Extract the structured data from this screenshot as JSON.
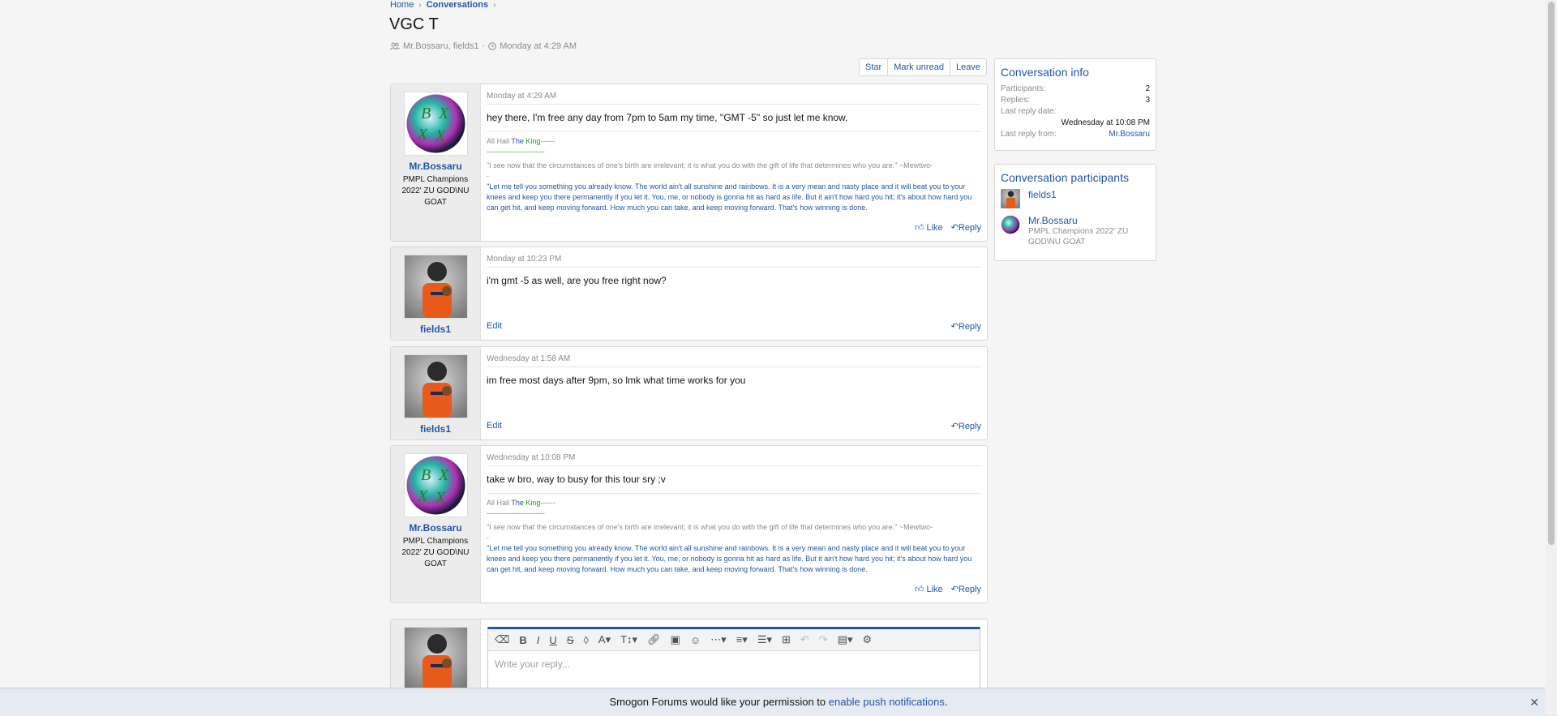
{
  "breadcrumb": {
    "home": "Home",
    "conversations": "Conversations"
  },
  "conversation": {
    "title": "VGC T",
    "participants_meta": "Mr.Bossaru, fields1",
    "started": "Monday at 4:29 AM"
  },
  "actions": {
    "star": "Star",
    "mark_unread": "Mark unread",
    "leave": "Leave"
  },
  "signature": {
    "hail": "All Hail ",
    "the": "The",
    "king": "King",
    "hail_tail": "------",
    "dashes": "------------------------",
    "quote1": "\"I see now that the circumstances of one's birth are irrelevant; it is what you do with the gift of life that determines who you are.\" ~Mewtwo-",
    "quote1_tail": "-",
    "quote2": "''Let me tell you something you already know. The world ain't all sunshine and rainbows. It is a very mean and nasty place and it will beat you to your knees and keep you there permanently if you let it. You, me, or nobody is gonna hit as hard as life. But it ain't how hard you hit; it's about how hard you can get hit, and keep moving forward. How much you can take, and keep moving forward. That's how winning is done."
  },
  "messages": [
    {
      "user": "Mr.Bossaru",
      "user_title": "PMPL Champions 2022' ZU GOD\\NU GOAT",
      "date": "Monday at 4:29 AM",
      "text": "hey there, I'm free any day from 7pm to 5am my time, ''GMT -5'' so just let me know,",
      "like": "Like",
      "reply": "Reply"
    },
    {
      "user": "fields1",
      "date": "Monday at 10:23 PM",
      "text": "i'm gmt -5 as well, are you free right now?",
      "edit": "Edit",
      "reply": "Reply"
    },
    {
      "user": "fields1",
      "date": "Wednesday at 1:58 AM",
      "text": "im free most days after 9pm, so lmk what time works for you",
      "edit": "Edit",
      "reply": "Reply"
    },
    {
      "user": "Mr.Bossaru",
      "user_title": "PMPL Champions 2022' ZU GOD\\NU GOAT",
      "date": "Wednesday at 10:08 PM",
      "text": "take w bro, way to busy for this tour sry ;v",
      "like": "Like",
      "reply": "Reply"
    }
  ],
  "info": {
    "heading": "Conversation info",
    "participants_label": "Participants:",
    "participants_value": "2",
    "replies_label": "Replies:",
    "replies_value": "3",
    "last_reply_date_label": "Last reply date:",
    "last_reply_date_value": "Wednesday at 10:08 PM",
    "last_reply_from_label": "Last reply from:",
    "last_reply_from_value": "Mr.Bossaru"
  },
  "participants": {
    "heading": "Conversation participants",
    "list": [
      {
        "name": "fields1"
      },
      {
        "name": "Mr.Bossaru",
        "title": "PMPL Champions 2022' ZU GOD\\NU GOAT"
      }
    ]
  },
  "editor": {
    "placeholder": "Write your reply..."
  },
  "notice": {
    "text": "Smogon Forums would like your permission to ",
    "link": "enable push notifications",
    "period": "."
  },
  "colors": {
    "link": "#2456a6",
    "accent_green": "#1d9a1d",
    "background": "#f5f5f5"
  }
}
